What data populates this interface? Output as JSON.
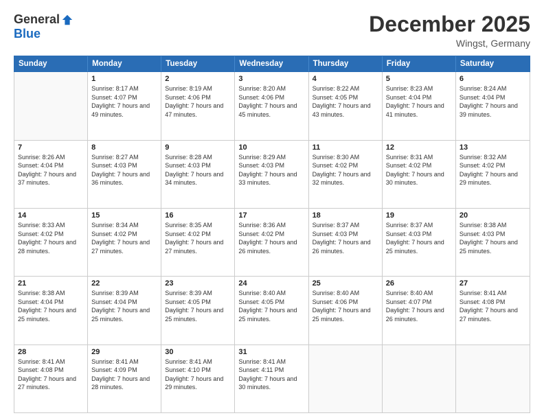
{
  "header": {
    "logo_general": "General",
    "logo_blue": "Blue",
    "month_title": "December 2025",
    "location": "Wingst, Germany"
  },
  "days_of_week": [
    "Sunday",
    "Monday",
    "Tuesday",
    "Wednesday",
    "Thursday",
    "Friday",
    "Saturday"
  ],
  "weeks": [
    [
      {
        "day": "",
        "sunrise": "",
        "sunset": "",
        "daylight": ""
      },
      {
        "day": "1",
        "sunrise": "Sunrise: 8:17 AM",
        "sunset": "Sunset: 4:07 PM",
        "daylight": "Daylight: 7 hours and 49 minutes."
      },
      {
        "day": "2",
        "sunrise": "Sunrise: 8:19 AM",
        "sunset": "Sunset: 4:06 PM",
        "daylight": "Daylight: 7 hours and 47 minutes."
      },
      {
        "day": "3",
        "sunrise": "Sunrise: 8:20 AM",
        "sunset": "Sunset: 4:06 PM",
        "daylight": "Daylight: 7 hours and 45 minutes."
      },
      {
        "day": "4",
        "sunrise": "Sunrise: 8:22 AM",
        "sunset": "Sunset: 4:05 PM",
        "daylight": "Daylight: 7 hours and 43 minutes."
      },
      {
        "day": "5",
        "sunrise": "Sunrise: 8:23 AM",
        "sunset": "Sunset: 4:04 PM",
        "daylight": "Daylight: 7 hours and 41 minutes."
      },
      {
        "day": "6",
        "sunrise": "Sunrise: 8:24 AM",
        "sunset": "Sunset: 4:04 PM",
        "daylight": "Daylight: 7 hours and 39 minutes."
      }
    ],
    [
      {
        "day": "7",
        "sunrise": "Sunrise: 8:26 AM",
        "sunset": "Sunset: 4:04 PM",
        "daylight": "Daylight: 7 hours and 37 minutes."
      },
      {
        "day": "8",
        "sunrise": "Sunrise: 8:27 AM",
        "sunset": "Sunset: 4:03 PM",
        "daylight": "Daylight: 7 hours and 36 minutes."
      },
      {
        "day": "9",
        "sunrise": "Sunrise: 8:28 AM",
        "sunset": "Sunset: 4:03 PM",
        "daylight": "Daylight: 7 hours and 34 minutes."
      },
      {
        "day": "10",
        "sunrise": "Sunrise: 8:29 AM",
        "sunset": "Sunset: 4:03 PM",
        "daylight": "Daylight: 7 hours and 33 minutes."
      },
      {
        "day": "11",
        "sunrise": "Sunrise: 8:30 AM",
        "sunset": "Sunset: 4:02 PM",
        "daylight": "Daylight: 7 hours and 32 minutes."
      },
      {
        "day": "12",
        "sunrise": "Sunrise: 8:31 AM",
        "sunset": "Sunset: 4:02 PM",
        "daylight": "Daylight: 7 hours and 30 minutes."
      },
      {
        "day": "13",
        "sunrise": "Sunrise: 8:32 AM",
        "sunset": "Sunset: 4:02 PM",
        "daylight": "Daylight: 7 hours and 29 minutes."
      }
    ],
    [
      {
        "day": "14",
        "sunrise": "Sunrise: 8:33 AM",
        "sunset": "Sunset: 4:02 PM",
        "daylight": "Daylight: 7 hours and 28 minutes."
      },
      {
        "day": "15",
        "sunrise": "Sunrise: 8:34 AM",
        "sunset": "Sunset: 4:02 PM",
        "daylight": "Daylight: 7 hours and 27 minutes."
      },
      {
        "day": "16",
        "sunrise": "Sunrise: 8:35 AM",
        "sunset": "Sunset: 4:02 PM",
        "daylight": "Daylight: 7 hours and 27 minutes."
      },
      {
        "day": "17",
        "sunrise": "Sunrise: 8:36 AM",
        "sunset": "Sunset: 4:02 PM",
        "daylight": "Daylight: 7 hours and 26 minutes."
      },
      {
        "day": "18",
        "sunrise": "Sunrise: 8:37 AM",
        "sunset": "Sunset: 4:03 PM",
        "daylight": "Daylight: 7 hours and 26 minutes."
      },
      {
        "day": "19",
        "sunrise": "Sunrise: 8:37 AM",
        "sunset": "Sunset: 4:03 PM",
        "daylight": "Daylight: 7 hours and 25 minutes."
      },
      {
        "day": "20",
        "sunrise": "Sunrise: 8:38 AM",
        "sunset": "Sunset: 4:03 PM",
        "daylight": "Daylight: 7 hours and 25 minutes."
      }
    ],
    [
      {
        "day": "21",
        "sunrise": "Sunrise: 8:38 AM",
        "sunset": "Sunset: 4:04 PM",
        "daylight": "Daylight: 7 hours and 25 minutes."
      },
      {
        "day": "22",
        "sunrise": "Sunrise: 8:39 AM",
        "sunset": "Sunset: 4:04 PM",
        "daylight": "Daylight: 7 hours and 25 minutes."
      },
      {
        "day": "23",
        "sunrise": "Sunrise: 8:39 AM",
        "sunset": "Sunset: 4:05 PM",
        "daylight": "Daylight: 7 hours and 25 minutes."
      },
      {
        "day": "24",
        "sunrise": "Sunrise: 8:40 AM",
        "sunset": "Sunset: 4:05 PM",
        "daylight": "Daylight: 7 hours and 25 minutes."
      },
      {
        "day": "25",
        "sunrise": "Sunrise: 8:40 AM",
        "sunset": "Sunset: 4:06 PM",
        "daylight": "Daylight: 7 hours and 25 minutes."
      },
      {
        "day": "26",
        "sunrise": "Sunrise: 8:40 AM",
        "sunset": "Sunset: 4:07 PM",
        "daylight": "Daylight: 7 hours and 26 minutes."
      },
      {
        "day": "27",
        "sunrise": "Sunrise: 8:41 AM",
        "sunset": "Sunset: 4:08 PM",
        "daylight": "Daylight: 7 hours and 27 minutes."
      }
    ],
    [
      {
        "day": "28",
        "sunrise": "Sunrise: 8:41 AM",
        "sunset": "Sunset: 4:08 PM",
        "daylight": "Daylight: 7 hours and 27 minutes."
      },
      {
        "day": "29",
        "sunrise": "Sunrise: 8:41 AM",
        "sunset": "Sunset: 4:09 PM",
        "daylight": "Daylight: 7 hours and 28 minutes."
      },
      {
        "day": "30",
        "sunrise": "Sunrise: 8:41 AM",
        "sunset": "Sunset: 4:10 PM",
        "daylight": "Daylight: 7 hours and 29 minutes."
      },
      {
        "day": "31",
        "sunrise": "Sunrise: 8:41 AM",
        "sunset": "Sunset: 4:11 PM",
        "daylight": "Daylight: 7 hours and 30 minutes."
      },
      {
        "day": "",
        "sunrise": "",
        "sunset": "",
        "daylight": ""
      },
      {
        "day": "",
        "sunrise": "",
        "sunset": "",
        "daylight": ""
      },
      {
        "day": "",
        "sunrise": "",
        "sunset": "",
        "daylight": ""
      }
    ]
  ]
}
